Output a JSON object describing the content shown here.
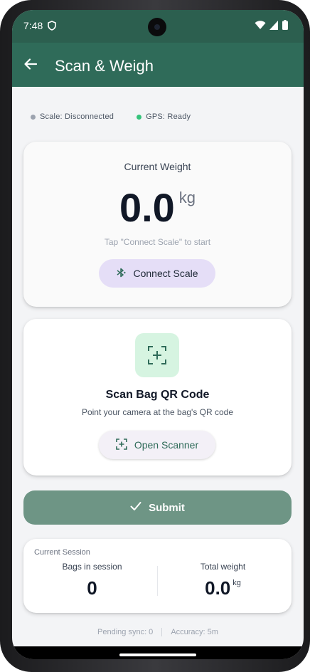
{
  "statusbar": {
    "time": "7:48",
    "icons": [
      "shield-icon",
      "wifi-icon",
      "signal-icon",
      "battery-icon"
    ]
  },
  "appbar": {
    "title": "Scan & Weigh",
    "back_icon": "arrow-left-icon"
  },
  "status": {
    "scale": "Scale: Disconnected",
    "scale_color": "#9ca3af",
    "gps": "GPS: Ready",
    "gps_color": "#34c37a"
  },
  "weight_card": {
    "label": "Current Weight",
    "value": "0.0",
    "unit": "kg",
    "hint": "Tap \"Connect Scale\" to start",
    "connect_label": "Connect Scale",
    "connect_icon": "bluetooth-searching-icon"
  },
  "scan_card": {
    "icon": "qr-scan-icon",
    "title": "Scan Bag QR Code",
    "subtitle": "Point your camera at the bag's QR code",
    "button_label": "Open Scanner"
  },
  "submit": {
    "label": "Submit",
    "icon": "check-icon"
  },
  "session": {
    "title": "Current Session",
    "bags_label": "Bags in session",
    "bags_value": "0",
    "weight_label": "Total weight",
    "weight_value": "0.0",
    "weight_unit": "kg"
  },
  "footer": {
    "pending": "Pending sync: 0",
    "accuracy": "Accuracy: 5m"
  },
  "colors": {
    "primary": "#2f6b59",
    "statusbar": "#2c5f4f",
    "submit": "#6e9585",
    "connect_button": "#e5def7",
    "qr_box": "#d6f4e1"
  }
}
